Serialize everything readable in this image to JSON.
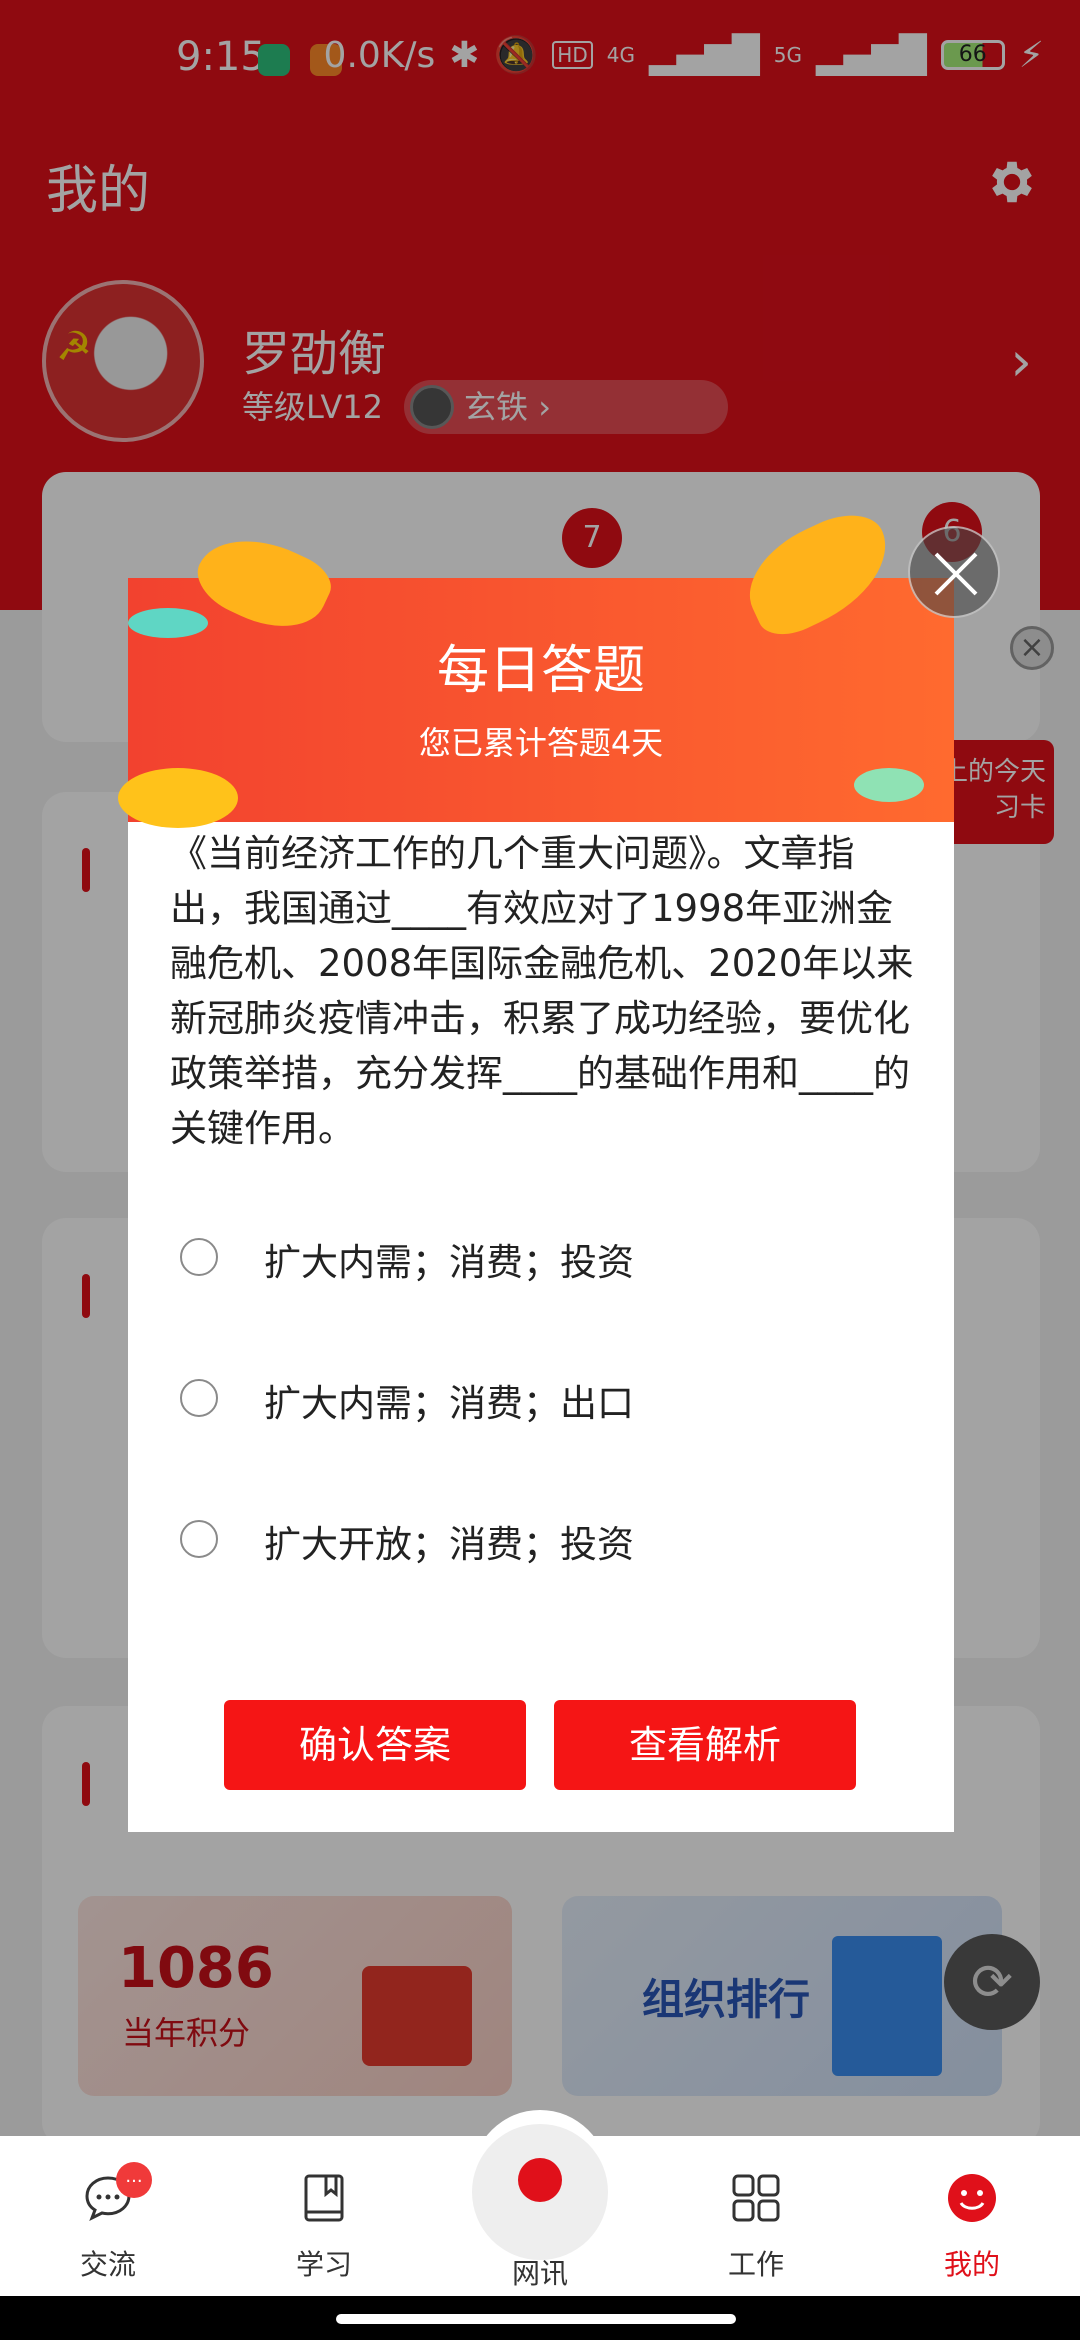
{
  "status_bar": {
    "time": "9:15",
    "net_speed": "0.0K/s",
    "signal_4g": "4G",
    "signal_5g": "5G",
    "hd": "HD",
    "battery": "66"
  },
  "header": {
    "title": "我的"
  },
  "profile": {
    "name": "罗劭衡",
    "level": "等级LV12",
    "rank_badge": "玄铁",
    "rank_arrow": "›"
  },
  "stats": {
    "badge_a": "7",
    "badge_b": "6"
  },
  "side_promo": {
    "line1": "上的今天",
    "line2": "习卡"
  },
  "cards": {
    "points_value": "1086",
    "points_label": "当年积分",
    "rank_label": "组织排行"
  },
  "dialog": {
    "title": "每日答题",
    "subtitle": "您已累计答题4天",
    "question": "《当前经济工作的几个重大问题》。文章指出，我国通过____有效应对了1998年亚洲金融危机、2008年国际金融危机、2020年以来新冠肺炎疫情冲击，积累了成功经验，要优化政策举措，充分发挥____的基础作用和____的关键作用。",
    "options": [
      {
        "label": "扩大内需；消费；投资"
      },
      {
        "label": "扩大内需；消费；出口"
      },
      {
        "label": "扩大开放；消费；投资"
      }
    ],
    "confirm_label": "确认答案",
    "analysis_label": "查看解析"
  },
  "nav": {
    "items": [
      {
        "label": "交流",
        "badge": "..."
      },
      {
        "label": "学习"
      },
      {
        "label": "网讯"
      },
      {
        "label": "工作"
      },
      {
        "label": "我的"
      }
    ]
  }
}
